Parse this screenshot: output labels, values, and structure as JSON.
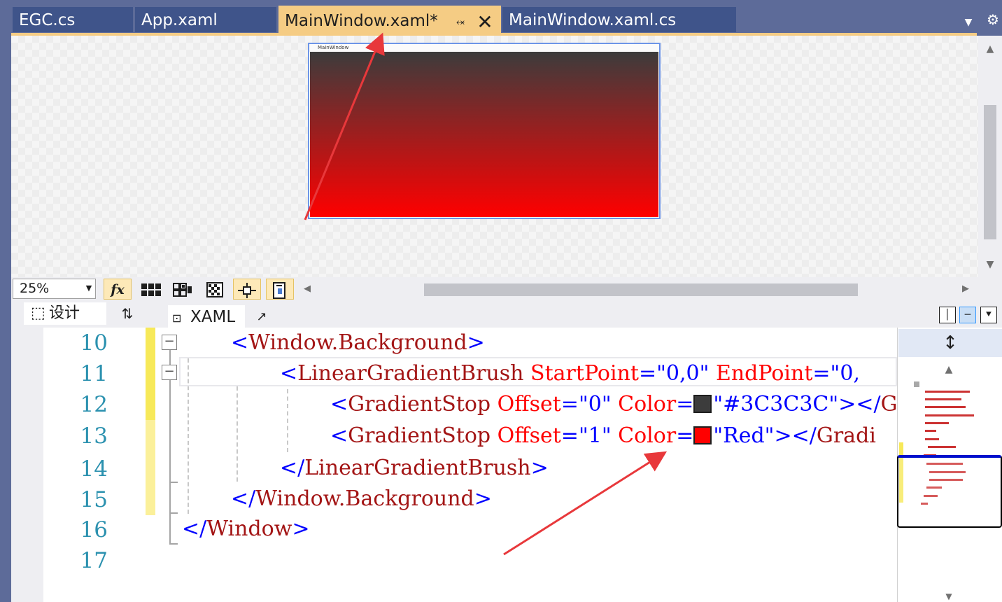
{
  "tabs": [
    {
      "label": "EGC.cs",
      "active": false
    },
    {
      "label": "App.xaml",
      "active": false
    },
    {
      "label": "MainWindow.xaml*",
      "active": true
    },
    {
      "label": "MainWindow.xaml.cs",
      "active": false
    }
  ],
  "designer": {
    "preview_window_title": "MainWindow",
    "gradient": {
      "start_color": "#3C3C3C",
      "end_color": "#FF0000"
    },
    "zoom": "25%"
  },
  "split": {
    "design_label": "设计",
    "xaml_label": "XAML"
  },
  "editor": {
    "line_numbers": [
      "10",
      "11",
      "12",
      "13",
      "14",
      "15",
      "16",
      "17"
    ],
    "line10": {
      "open": "<",
      "tag": "Window.Background",
      "close": ">"
    },
    "line11": {
      "open": "<",
      "tag": "LinearGradientBrush",
      "attr1": " StartPoint",
      "eq1": "=",
      "val1": "\"0,0\"",
      "attr2": " EndPoint",
      "eq2": "=",
      "val2": "\"0,"
    },
    "line12": {
      "open": "<",
      "tag": "GradientStop",
      "attr1": " Offset",
      "eq1": "=",
      "val1": "\"0\"",
      "attr2": " Color",
      "eq2": "=",
      "val2": "\"#3C3C3C\"",
      "close": "></",
      "tail": "G"
    },
    "line13": {
      "open": "<",
      "tag": "GradientStop",
      "attr1": " Offset",
      "eq1": "=",
      "val1": "\"1\"",
      "attr2": " Color",
      "eq2": "=",
      "val2": "\"Red\"",
      "close": "></",
      "tail": "Gradi"
    },
    "line14": {
      "open": "</",
      "tag": "LinearGradientBrush",
      "close": ">"
    },
    "line15": {
      "open": "</",
      "tag": "Window.Background",
      "close": ">"
    },
    "line16": {
      "open": "</",
      "tag": "Window",
      "close": ">"
    },
    "swatch_colors": {
      "dark": "#3C3C3C",
      "red": "#FF0000"
    }
  },
  "icons": {
    "pin": "pin-icon",
    "close": "close-icon",
    "gear": "gear-icon",
    "fx": "fx-icon",
    "grid": "grid-icon",
    "snap": "snap-grid-icon",
    "artboard": "artboard-icon",
    "snap_lines": "snap-lines-icon",
    "device": "device-icon"
  },
  "accent": {
    "active_tab": "#F5CC84",
    "annotation_arrow": "#E8383B"
  }
}
